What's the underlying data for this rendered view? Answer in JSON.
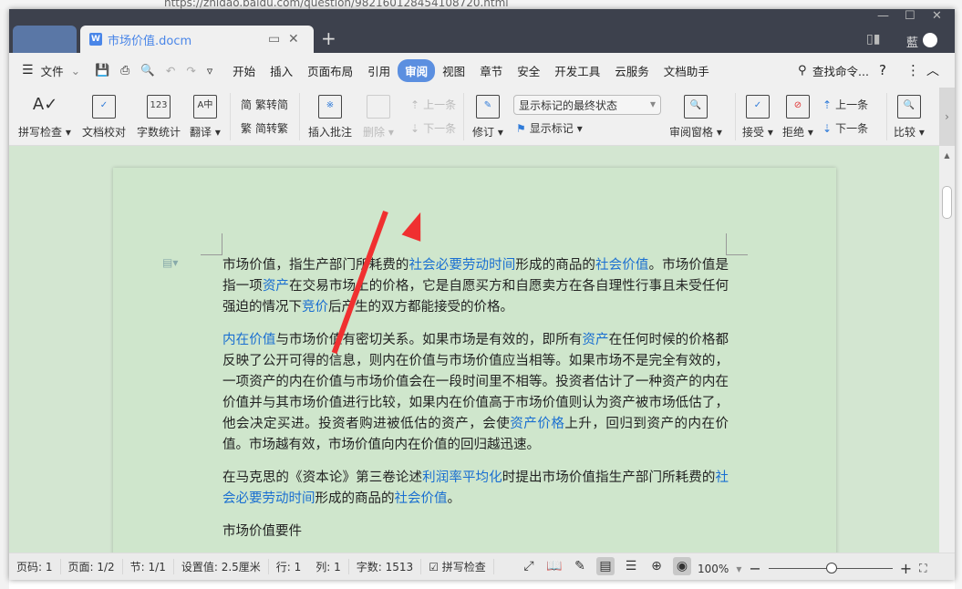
{
  "browser": {
    "url": "https://zhidao.baidu.com/question/982160128454108720.html"
  },
  "tabs": [
    {
      "label": "市场价值.docm"
    }
  ],
  "menu": {
    "file": "文件",
    "items": [
      "开始",
      "插入",
      "页面布局",
      "引用",
      "审阅",
      "视图",
      "章节",
      "安全",
      "开发工具",
      "云服务",
      "文档助手"
    ],
    "active": "审阅",
    "search": "查找命令...",
    "user_initial": "藍"
  },
  "ribbon": {
    "spell": "拼写检查",
    "proof": "文档校对",
    "wordcount": "字数统计",
    "translate": "翻译",
    "t2s": "繁转简",
    "s2t": "简转繁",
    "insert_comment": "插入批注",
    "delete": "删除",
    "prev_comment": "上一条",
    "next_comment": "下一条",
    "track": "修订",
    "markup_mode": "显示标记的最终状态",
    "show_markup": "显示标记",
    "review_pane": "审阅窗格",
    "accept": "接受",
    "reject": "拒绝",
    "prev": "上一条",
    "next": "下一条",
    "compare": "比较"
  },
  "document": {
    "paragraphs": [
      [
        {
          "t": "市场价值，指生产部门所耗费的"
        },
        {
          "t": "社会必要劳动时间",
          "link": true
        },
        {
          "t": "形成的商品的"
        },
        {
          "t": "社会价值",
          "link": true
        },
        {
          "t": "。市场价值是指一项"
        },
        {
          "t": "资产",
          "link": true
        },
        {
          "t": "在交易市场上的价格，它是自愿买方和自愿卖方在各自理性行事且未受任何强迫的情况下"
        },
        {
          "t": "竞价",
          "link": true
        },
        {
          "t": "后产生的双方都能接受的价格。"
        }
      ],
      [
        {
          "t": "内在价值",
          "link": true
        },
        {
          "t": "与市场价值有密切关系。如果市场是有效的，即所有"
        },
        {
          "t": "资产",
          "link": true
        },
        {
          "t": "在任何时候的价格都反映了公开可得的信息，则内在价值与市场价值应当相等。如果市场不是完全有效的，一项资产的内在价值与市场价值会在一段时间里不相等。投资者估计了一种资产的内在价值并与其市场价值进行比较，如果内在价值高于市场价值则认为资产被市场低估了，他会决定买进。投资者购进被低估的资产，会使"
        },
        {
          "t": "资产价格",
          "link": true
        },
        {
          "t": "上升，回归到资产的内在价值。市场越有效，市场价值向内在价值的回归越迅速。"
        }
      ],
      [
        {
          "t": "在马克思的《资本论》第三卷论述"
        },
        {
          "t": "利润率平均化",
          "link": true
        },
        {
          "t": "时提出市场价值指生产部门所耗费的"
        },
        {
          "t": "社会必要劳动时间",
          "link": true
        },
        {
          "t": "形成的商品的"
        },
        {
          "t": "社会价值",
          "link": true
        },
        {
          "t": "。"
        }
      ],
      [
        {
          "t": "市场价值要件"
        }
      ]
    ]
  },
  "status": {
    "page_num": "页码: 1",
    "pages": "页面: 1/2",
    "section": "节: 1/1",
    "setting": "设置值: 2.5厘米",
    "row": "行: 1",
    "col": "列: 1",
    "words": "字数: 1513",
    "spell": "拼写检查",
    "zoom": "100%",
    "zoom_level": 100
  },
  "colors": {
    "accent": "#5b8fe0",
    "link": "#1a6fd1",
    "titlebar": "#3d414d",
    "page_bg": "#cfe6cc"
  }
}
